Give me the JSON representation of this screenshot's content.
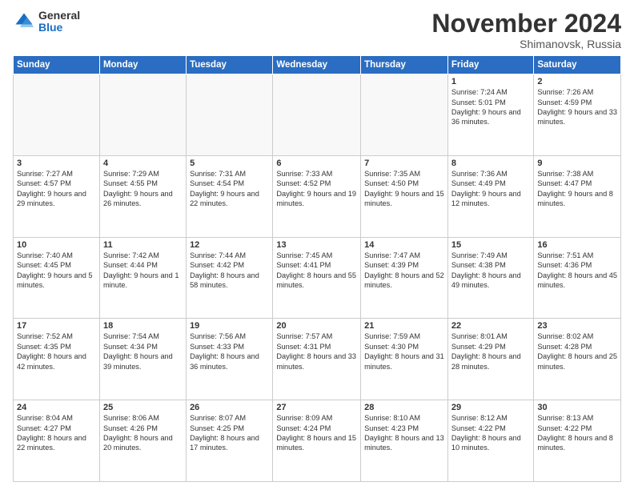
{
  "logo": {
    "general": "General",
    "blue": "Blue"
  },
  "header": {
    "month": "November 2024",
    "location": "Shimanovsk, Russia"
  },
  "weekdays": [
    "Sunday",
    "Monday",
    "Tuesday",
    "Wednesday",
    "Thursday",
    "Friday",
    "Saturday"
  ],
  "weeks": [
    [
      {
        "day": "",
        "info": ""
      },
      {
        "day": "",
        "info": ""
      },
      {
        "day": "",
        "info": ""
      },
      {
        "day": "",
        "info": ""
      },
      {
        "day": "",
        "info": ""
      },
      {
        "day": "1",
        "info": "Sunrise: 7:24 AM\nSunset: 5:01 PM\nDaylight: 9 hours and 36 minutes."
      },
      {
        "day": "2",
        "info": "Sunrise: 7:26 AM\nSunset: 4:59 PM\nDaylight: 9 hours and 33 minutes."
      }
    ],
    [
      {
        "day": "3",
        "info": "Sunrise: 7:27 AM\nSunset: 4:57 PM\nDaylight: 9 hours and 29 minutes."
      },
      {
        "day": "4",
        "info": "Sunrise: 7:29 AM\nSunset: 4:55 PM\nDaylight: 9 hours and 26 minutes."
      },
      {
        "day": "5",
        "info": "Sunrise: 7:31 AM\nSunset: 4:54 PM\nDaylight: 9 hours and 22 minutes."
      },
      {
        "day": "6",
        "info": "Sunrise: 7:33 AM\nSunset: 4:52 PM\nDaylight: 9 hours and 19 minutes."
      },
      {
        "day": "7",
        "info": "Sunrise: 7:35 AM\nSunset: 4:50 PM\nDaylight: 9 hours and 15 minutes."
      },
      {
        "day": "8",
        "info": "Sunrise: 7:36 AM\nSunset: 4:49 PM\nDaylight: 9 hours and 12 minutes."
      },
      {
        "day": "9",
        "info": "Sunrise: 7:38 AM\nSunset: 4:47 PM\nDaylight: 9 hours and 8 minutes."
      }
    ],
    [
      {
        "day": "10",
        "info": "Sunrise: 7:40 AM\nSunset: 4:45 PM\nDaylight: 9 hours and 5 minutes."
      },
      {
        "day": "11",
        "info": "Sunrise: 7:42 AM\nSunset: 4:44 PM\nDaylight: 9 hours and 1 minute."
      },
      {
        "day": "12",
        "info": "Sunrise: 7:44 AM\nSunset: 4:42 PM\nDaylight: 8 hours and 58 minutes."
      },
      {
        "day": "13",
        "info": "Sunrise: 7:45 AM\nSunset: 4:41 PM\nDaylight: 8 hours and 55 minutes."
      },
      {
        "day": "14",
        "info": "Sunrise: 7:47 AM\nSunset: 4:39 PM\nDaylight: 8 hours and 52 minutes."
      },
      {
        "day": "15",
        "info": "Sunrise: 7:49 AM\nSunset: 4:38 PM\nDaylight: 8 hours and 49 minutes."
      },
      {
        "day": "16",
        "info": "Sunrise: 7:51 AM\nSunset: 4:36 PM\nDaylight: 8 hours and 45 minutes."
      }
    ],
    [
      {
        "day": "17",
        "info": "Sunrise: 7:52 AM\nSunset: 4:35 PM\nDaylight: 8 hours and 42 minutes."
      },
      {
        "day": "18",
        "info": "Sunrise: 7:54 AM\nSunset: 4:34 PM\nDaylight: 8 hours and 39 minutes."
      },
      {
        "day": "19",
        "info": "Sunrise: 7:56 AM\nSunset: 4:33 PM\nDaylight: 8 hours and 36 minutes."
      },
      {
        "day": "20",
        "info": "Sunrise: 7:57 AM\nSunset: 4:31 PM\nDaylight: 8 hours and 33 minutes."
      },
      {
        "day": "21",
        "info": "Sunrise: 7:59 AM\nSunset: 4:30 PM\nDaylight: 8 hours and 31 minutes."
      },
      {
        "day": "22",
        "info": "Sunrise: 8:01 AM\nSunset: 4:29 PM\nDaylight: 8 hours and 28 minutes."
      },
      {
        "day": "23",
        "info": "Sunrise: 8:02 AM\nSunset: 4:28 PM\nDaylight: 8 hours and 25 minutes."
      }
    ],
    [
      {
        "day": "24",
        "info": "Sunrise: 8:04 AM\nSunset: 4:27 PM\nDaylight: 8 hours and 22 minutes."
      },
      {
        "day": "25",
        "info": "Sunrise: 8:06 AM\nSunset: 4:26 PM\nDaylight: 8 hours and 20 minutes."
      },
      {
        "day": "26",
        "info": "Sunrise: 8:07 AM\nSunset: 4:25 PM\nDaylight: 8 hours and 17 minutes."
      },
      {
        "day": "27",
        "info": "Sunrise: 8:09 AM\nSunset: 4:24 PM\nDaylight: 8 hours and 15 minutes."
      },
      {
        "day": "28",
        "info": "Sunrise: 8:10 AM\nSunset: 4:23 PM\nDaylight: 8 hours and 13 minutes."
      },
      {
        "day": "29",
        "info": "Sunrise: 8:12 AM\nSunset: 4:22 PM\nDaylight: 8 hours and 10 minutes."
      },
      {
        "day": "30",
        "info": "Sunrise: 8:13 AM\nSunset: 4:22 PM\nDaylight: 8 hours and 8 minutes."
      }
    ]
  ]
}
